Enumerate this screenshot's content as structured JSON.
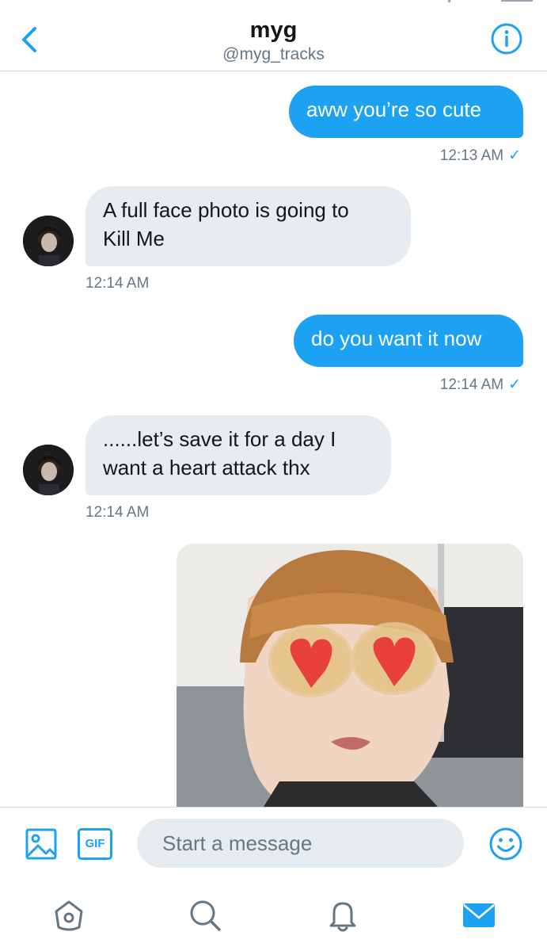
{
  "header": {
    "title": "myg",
    "handle": "@myg_tracks"
  },
  "messages": [
    {
      "direction": "outgoing",
      "text": "aww you’re so cute",
      "time": "12:13 AM",
      "read_mark": "✓"
    },
    {
      "direction": "incoming",
      "lines": [
        "A full face photo is going to",
        "Kill Me"
      ],
      "time": "12:14 AM"
    },
    {
      "direction": "outgoing",
      "text": "do you want it now",
      "time": "12:14 AM",
      "read_mark": "✓"
    },
    {
      "direction": "incoming",
      "lines": [
        "......let’s save it for a day I",
        "want a heart attack thx"
      ],
      "time": "12:14 AM"
    },
    {
      "direction": "outgoing",
      "type": "photo"
    }
  ],
  "composer": {
    "gif_label": "GIF",
    "placeholder": "Start a message"
  },
  "icons": {
    "back": "chevron-left-icon",
    "info": "info-icon",
    "image": "image-icon",
    "gif": "gif-icon",
    "emoji": "emoji-icon",
    "home": "home-icon",
    "search": "search-icon",
    "notifications": "bell-icon",
    "messages": "envelope-icon"
  },
  "colors": {
    "accent": "#1da1f2",
    "incoming_bubble": "#e6ecf0",
    "secondary_text": "#657786",
    "tab_inactive": "#657786"
  }
}
